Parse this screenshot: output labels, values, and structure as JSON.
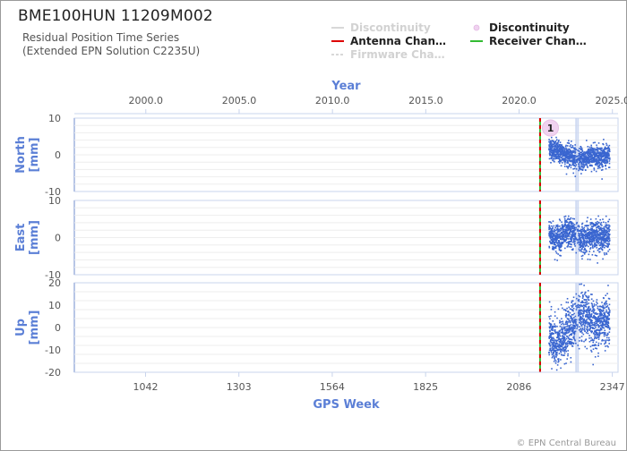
{
  "header": {
    "title": "BME100HUN 11209M002",
    "subtitle_line1": "Residual Position Time Series",
    "subtitle_line2": "(Extended EPN Solution C2235U)"
  },
  "legend": {
    "items": [
      {
        "label": "Discontinuity",
        "state": "faded",
        "style": "line",
        "color": "#d8d8d8"
      },
      {
        "label": "Discontinuity",
        "state": "active",
        "style": "dot",
        "color": "#f0d2f0"
      },
      {
        "label": "Antenna Chan…",
        "state": "active",
        "style": "line",
        "color": "#dd0000"
      },
      {
        "label": "Receiver Chan…",
        "state": "active",
        "style": "line",
        "color": "#33bb33"
      },
      {
        "label": "Firmware Cha…",
        "state": "faded",
        "style": "dashed",
        "color": "#d8d8d8"
      }
    ]
  },
  "footer": {
    "copyright": "© EPN Central Bureau"
  },
  "chart_data": {
    "type": "scatter",
    "top_axis": {
      "label": "Year",
      "ticks": [
        "2000.0",
        "2005.0",
        "2010.0",
        "2015.0",
        "2020.0",
        "2025.0"
      ],
      "tick_values": [
        2000.0,
        2005.0,
        2010.0,
        2015.0,
        2020.0,
        2025.0
      ]
    },
    "bottom_axis": {
      "label": "GPS Week",
      "ticks": [
        "1042",
        "1303",
        "1564",
        "1825",
        "2086",
        "2347"
      ],
      "tick_values": [
        1042,
        1303,
        1564,
        1825,
        2086,
        2347
      ],
      "range": [
        843,
        2363
      ]
    },
    "series_color": "#3a66d0",
    "events": {
      "antenna_receiver_change_week": 2145,
      "discontinuity_markers": [
        {
          "label": "1",
          "week": 2174
        }
      ],
      "vertical_gaps_weeks": [
        2245,
        2248,
        2252
      ]
    },
    "panels": [
      {
        "component": "North",
        "unit": "[mm]",
        "ylim": [
          -10,
          10
        ],
        "y_ticks": [
          "10",
          "0",
          "-10"
        ],
        "y_tick_values": [
          10,
          0,
          -10
        ],
        "data_start_week": 2170,
        "data_end_week": 2340,
        "mean_mm": 0.5,
        "spread_mm": 1.5,
        "points": [
          [
            2170,
            2.1
          ],
          [
            2185,
            1.2
          ],
          [
            2200,
            0.6
          ],
          [
            2215,
            0.1
          ],
          [
            2230,
            -0.4
          ],
          [
            2260,
            -1.3
          ],
          [
            2280,
            -0.9
          ],
          [
            2300,
            -0.2
          ],
          [
            2320,
            -0.6
          ],
          [
            2340,
            -0.3
          ]
        ]
      },
      {
        "component": "East",
        "unit": "[mm]",
        "ylim": [
          -10,
          10
        ],
        "y_ticks": [
          "10",
          "0",
          "-10"
        ],
        "y_tick_values": [
          10,
          0,
          -10
        ],
        "data_start_week": 2170,
        "data_end_week": 2340,
        "mean_mm": 0.0,
        "spread_mm": 2.0,
        "points": [
          [
            2170,
            1.0
          ],
          [
            2190,
            -0.5
          ],
          [
            2210,
            0.8
          ],
          [
            2230,
            1.5
          ],
          [
            2260,
            -0.6
          ],
          [
            2280,
            0.2
          ],
          [
            2300,
            0.9
          ],
          [
            2320,
            0.1
          ],
          [
            2340,
            0.4
          ]
        ]
      },
      {
        "component": "Up",
        "unit": "[mm]",
        "ylim": [
          -20,
          20
        ],
        "y_ticks": [
          "20",
          "10",
          "0",
          "-10",
          "-20"
        ],
        "y_tick_values": [
          20,
          10,
          0,
          -10,
          -20
        ],
        "data_start_week": 2170,
        "data_end_week": 2340,
        "mean_mm": 0.0,
        "spread_mm": 5.5,
        "points": [
          [
            2170,
            -3.0
          ],
          [
            2190,
            -9.0
          ],
          [
            2210,
            -5.0
          ],
          [
            2230,
            1.0
          ],
          [
            2260,
            4.0
          ],
          [
            2280,
            5.0
          ],
          [
            2300,
            0.0
          ],
          [
            2320,
            4.0
          ],
          [
            2340,
            3.0
          ]
        ]
      }
    ]
  }
}
